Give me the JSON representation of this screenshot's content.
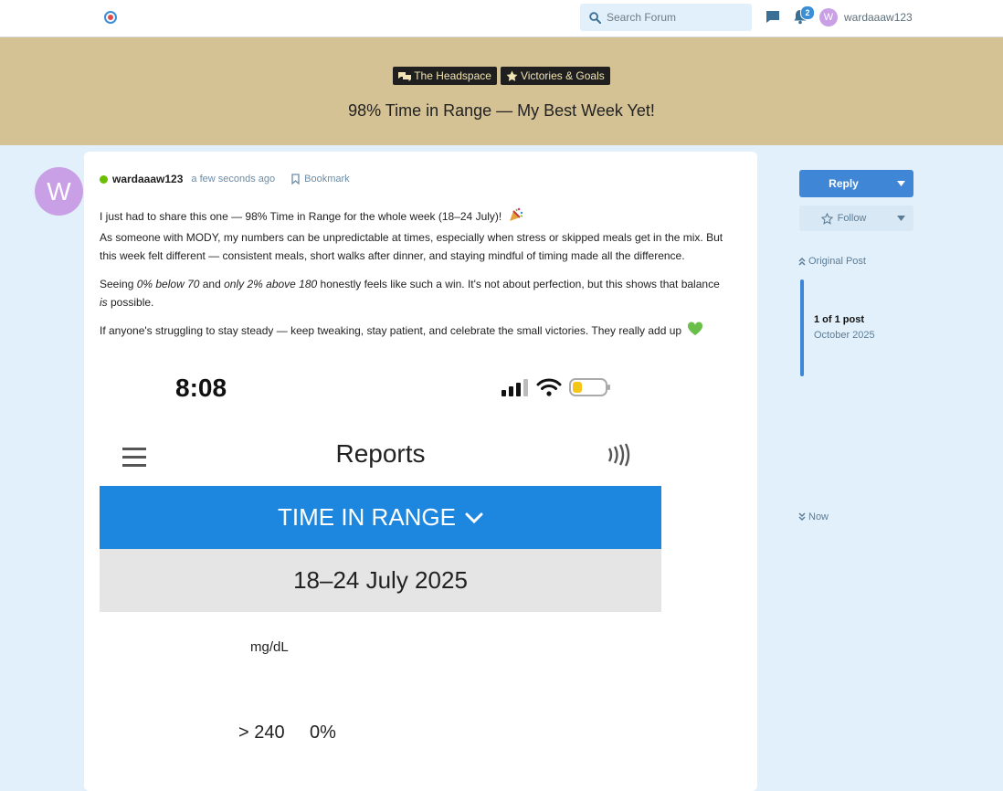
{
  "header": {
    "search_placeholder": "Search Forum",
    "notification_count": "2",
    "avatar_letter": "W",
    "username": "wardaaaw123"
  },
  "topic": {
    "tags": [
      {
        "label": "The Headspace",
        "icon": "comments-icon"
      },
      {
        "label": "Victories & Goals",
        "icon": "star-icon"
      }
    ],
    "title": "98% Time in Range — My Best Week Yet!"
  },
  "post": {
    "avatar_letter": "W",
    "author": "wardaaaw123",
    "time": "a few seconds ago",
    "bookmark_label": "Bookmark",
    "p1_line1": "I just had to share this one — 98% Time in Range for the whole week (18–24 July)!",
    "p1_line2": "As someone with MODY, my numbers can be unpredictable at times, especially when stress or skipped meals get in the mix. But this week felt different — consistent meals, short walks after dinner, and staying mindful of timing made all the difference.",
    "p2_a": "Seeing ",
    "p2_b": "0% below 70",
    "p2_c": " and ",
    "p2_d": "only 2% above 180",
    "p2_e": " honestly feels like such a win. It's not about perfection, but this shows that balance ",
    "p2_f": "is",
    "p2_g": " possible.",
    "p3": "If anyone's struggling to stay steady — keep tweaking, stay patient, and celebrate the small victories. They really add up",
    "colors": {
      "online": "#6cbf00",
      "heart": "#6abf4b"
    }
  },
  "screenshot": {
    "time": "8:08",
    "title": "Reports",
    "banner": "TIME IN RANGE",
    "date_range": "18–24 July 2025",
    "unit": "mg/dL",
    "row_label": "> 240",
    "row_value": "0%",
    "colors": {
      "banner": "#1d87e0",
      "date_bg": "#e5e5e5"
    }
  },
  "sidebar": {
    "reply_label": "Reply",
    "follow_label": "Follow",
    "original_post_label": "Original Post",
    "post_count": "1 of 1 post",
    "date": "October 2025",
    "now_label": "Now"
  },
  "theme": {
    "background": "#e2f0fb",
    "header_band": "#d4c294",
    "accent": "#3f86d7"
  }
}
